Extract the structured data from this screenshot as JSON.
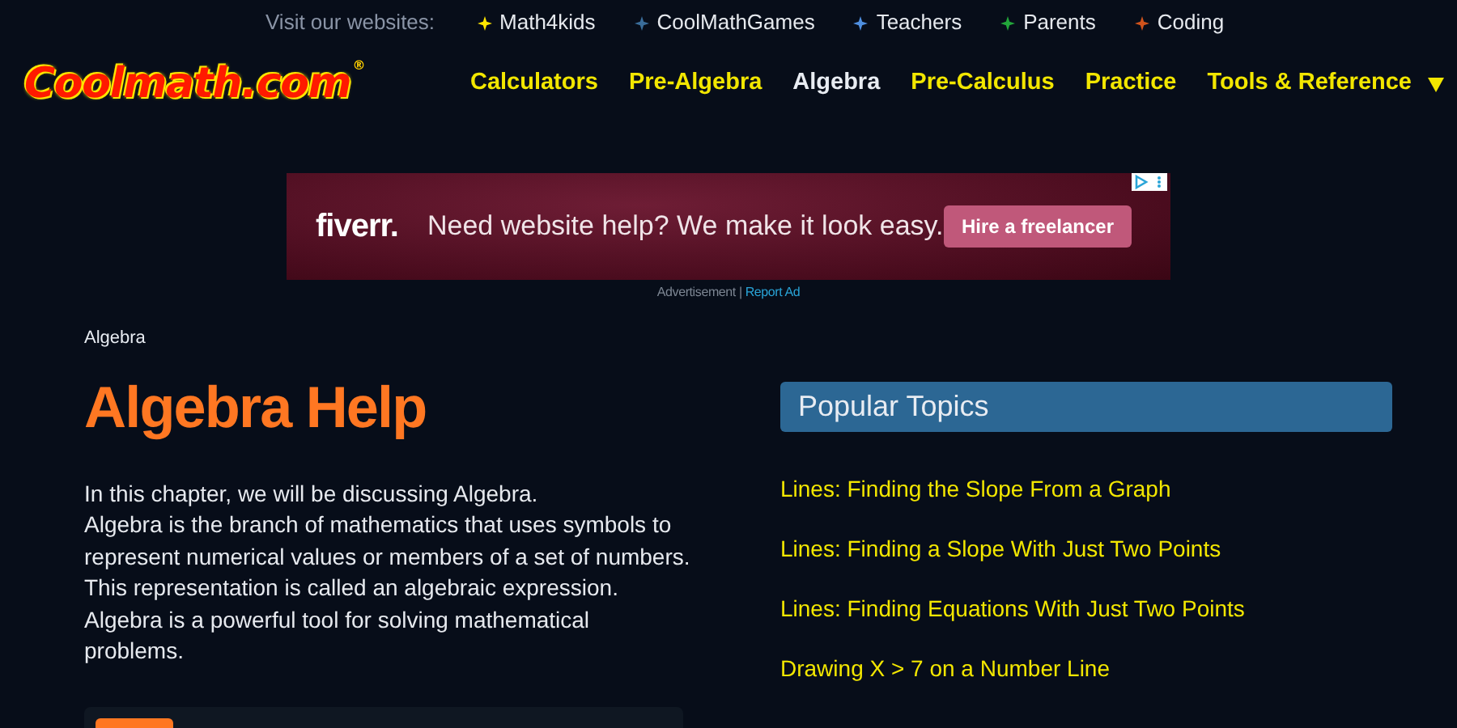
{
  "top_bar": {
    "label": "Visit our websites:",
    "sites": [
      {
        "label": "Math4kids",
        "color": "#ffe600"
      },
      {
        "label": "CoolMathGames",
        "color": "#3a6d9a"
      },
      {
        "label": "Teachers",
        "color": "#4f8fe0"
      },
      {
        "label": "Parents",
        "color": "#22a63a"
      },
      {
        "label": "Coding",
        "color": "#d0531c"
      }
    ]
  },
  "logo": {
    "text": "Coolmath.com",
    "mark": "®"
  },
  "nav": [
    {
      "label": "Calculators",
      "selected": false
    },
    {
      "label": "Pre-Algebra",
      "selected": false
    },
    {
      "label": "Algebra",
      "selected": true
    },
    {
      "label": "Pre-Calculus",
      "selected": false
    },
    {
      "label": "Practice",
      "selected": false
    },
    {
      "label": "Tools & Reference",
      "selected": false,
      "dropdown": true
    }
  ],
  "ad": {
    "brand": "fiverr.",
    "headline": "Need website help? We make it look easy.",
    "button": "Hire a freelancer",
    "caption": "Advertisement",
    "separator": "|",
    "report": "Report Ad"
  },
  "breadcrumb": "Algebra",
  "title": "Algebra Help",
  "intro": [
    "In this chapter, we will be discussing Algebra.",
    "Algebra is the branch of mathematics that uses symbols to represent numerical values or members of a set of numbers. This representation is called an algebraic expression. Algebra is a powerful tool for solving mathematical problems."
  ],
  "popular_topics": {
    "title": "Popular Topics",
    "items": [
      "Lines: Finding the Slope From a Graph",
      "Lines: Finding a Slope With Just Two Points",
      "Lines: Finding Equations With Just Two Points",
      "Drawing X > 7 on a Number Line"
    ]
  }
}
